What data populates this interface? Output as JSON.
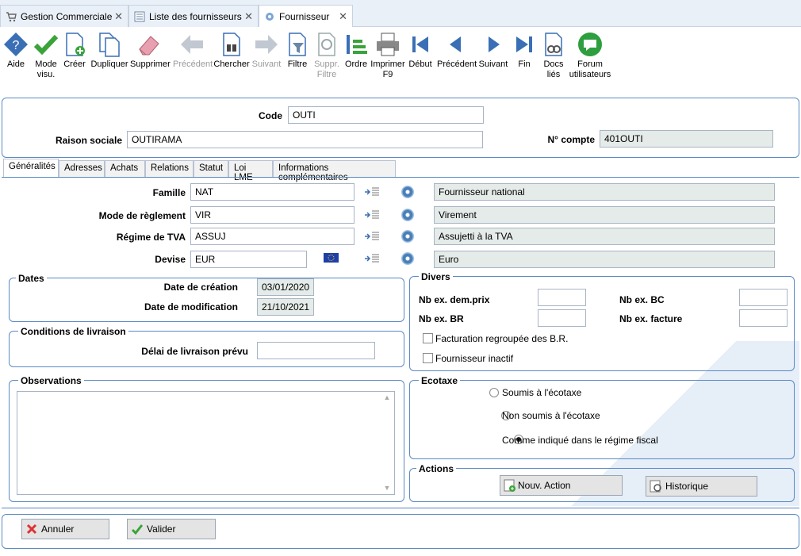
{
  "tabs": [
    {
      "label": "Gestion Commerciale"
    },
    {
      "label": "Liste des fournisseurs"
    },
    {
      "label": "Fournisseur"
    }
  ],
  "toolbar": {
    "aide": "Aide",
    "mode": [
      "Mode",
      "visu."
    ],
    "creer": "Créer",
    "dupliquer": "Dupliquer",
    "supprimer": "Supprimer",
    "precedent": "Précédent",
    "chercher": "Chercher",
    "suivant": "Suivant",
    "filtre": "Filtre",
    "suppr_filtre": [
      "Suppr.",
      "Filtre"
    ],
    "ordre": "Ordre",
    "imprimer": [
      "Imprimer",
      "F9"
    ],
    "debut": "Début",
    "precedent2": "Précédent",
    "suivant2": "Suivant",
    "fin": "Fin",
    "docs": [
      "Docs",
      "liés"
    ],
    "forum": [
      "Forum",
      "utilisateurs"
    ]
  },
  "header": {
    "code_label": "Code",
    "code_value": "OUTI",
    "raison_label": "Raison sociale",
    "raison_value": "OUTIRAMA",
    "compte_label": "N° compte",
    "compte_value": "401OUTI"
  },
  "subtabs": [
    "Généralités",
    "Adresses",
    "Achats",
    "Relations",
    "Statut",
    "Loi LME",
    "Informations complémentaires"
  ],
  "general": {
    "famille_label": "Famille",
    "famille_code": "NAT",
    "famille_desc": "Fournisseur national",
    "reglement_label": "Mode de règlement",
    "reglement_code": "VIR",
    "reglement_desc": "Virement",
    "tva_label": "Régime de TVA",
    "tva_code": "ASSUJ",
    "tva_desc": "Assujetti à la TVA",
    "devise_label": "Devise",
    "devise_code": "EUR",
    "devise_desc": "Euro"
  },
  "dates": {
    "title": "Dates",
    "creation_label": "Date de création",
    "creation_value": "03/01/2020",
    "modif_label": "Date de modification",
    "modif_value": "21/10/2021"
  },
  "livraison": {
    "title": "Conditions de livraison",
    "delai_label": "Délai de livraison prévu",
    "delai_value": ""
  },
  "observations": {
    "title": "Observations",
    "value": ""
  },
  "divers": {
    "title": "Divers",
    "dem_prix_label": "Nb ex. dem.prix",
    "bc_label": "Nb ex. BC",
    "br_label": "Nb ex. BR",
    "facture_label": "Nb ex. facture",
    "fact_regroupee": "Facturation regroupée des B.R.",
    "inactif": "Fournisseur inactif"
  },
  "ecotaxe": {
    "title": "Ecotaxe",
    "options": [
      "Soumis à l'écotaxe",
      "Non soumis à l'écotaxe",
      "Comme indiqué dans le régime fiscal"
    ],
    "selected_index": 2
  },
  "actions": {
    "title": "Actions",
    "nouv": "Nouv. Action",
    "historique": "Historique"
  },
  "footer": {
    "annuler": "Annuler",
    "valider": "Valider"
  },
  "colors": {
    "accent": "#5b8ac4",
    "readonly_bg": "#e4ebe8"
  }
}
